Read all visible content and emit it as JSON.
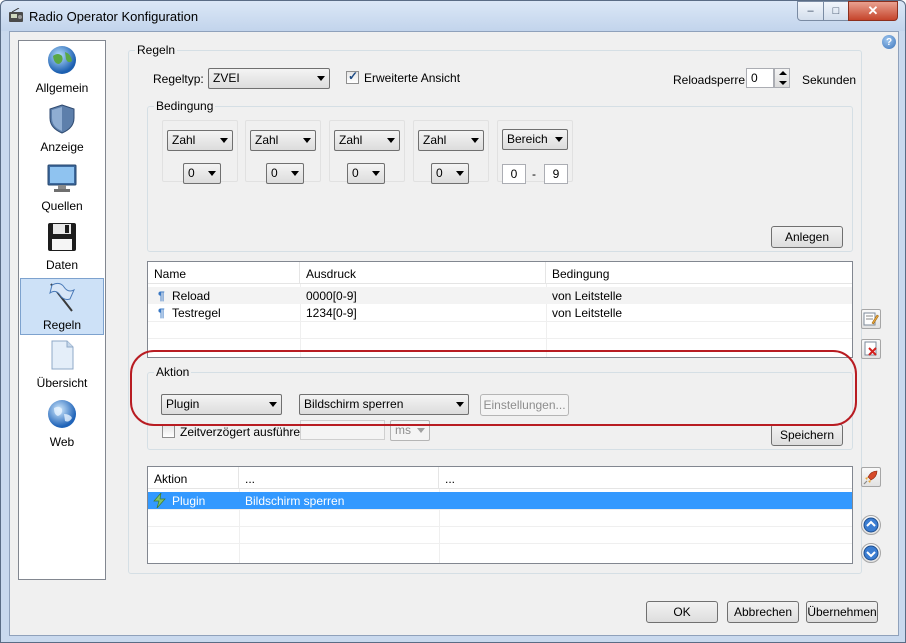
{
  "window": {
    "title": "Radio Operator Konfiguration",
    "minimize_glyph": "–",
    "maximize_glyph": "□",
    "close_glyph": "✕"
  },
  "help_glyph": "?",
  "sidebar": {
    "items": [
      {
        "label": "Allgemein",
        "icon": "globe-icon"
      },
      {
        "label": "Anzeige",
        "icon": "shield-icon"
      },
      {
        "label": "Quellen",
        "icon": "monitor-icon"
      },
      {
        "label": "Daten",
        "icon": "floppy-disk-icon"
      },
      {
        "label": "Regeln",
        "icon": "flag-icon",
        "active": true
      },
      {
        "label": "Übersicht",
        "icon": "document-icon"
      },
      {
        "label": "Web",
        "icon": "globe-icon"
      }
    ]
  },
  "rules_group": {
    "title": "Regeln",
    "regeltyp_label": "Regeltyp:",
    "regeltyp_value": "ZVEI",
    "extended_view_label": "Erweiterte Ansicht",
    "extended_view_checked": true,
    "reload_label": "Reloadsperre:",
    "reload_value": "0",
    "reload_unit": "Sekunden"
  },
  "condition_group": {
    "title": "Bedingung",
    "slots": [
      {
        "type": "Zahl",
        "value": "0"
      },
      {
        "type": "Zahl",
        "value": "0"
      },
      {
        "type": "Zahl",
        "value": "0"
      },
      {
        "type": "Zahl",
        "value": "0"
      }
    ],
    "range": {
      "type": "Bereich",
      "from": "0",
      "separator": "-",
      "to": "9"
    },
    "add_button": "Anlegen"
  },
  "rules_table": {
    "columns": [
      "Name",
      "Ausdruck",
      "Bedingung"
    ],
    "row_icon": "¶",
    "rows": [
      {
        "name": "Reload",
        "expression": "0000[0-9]",
        "condition": "von Leitstelle"
      },
      {
        "name": "Testregel",
        "expression": "1234[0-9]",
        "condition": "von Leitstelle"
      }
    ]
  },
  "action_group": {
    "title": "Aktion",
    "type_value": "Plugin",
    "plugin_value": "Bildschirm sperren",
    "settings_button": "Einstellungen...",
    "delayed_label": "Zeitverzögert ausführen",
    "delayed_checked": false,
    "delay_value": "",
    "delay_unit": "ms",
    "save_button": "Speichern"
  },
  "action_table": {
    "columns": [
      "Aktion",
      "...",
      "..."
    ],
    "rows": [
      {
        "action": "Plugin",
        "detail": "Bildschirm sperren",
        "extra": "",
        "selected": true
      }
    ]
  },
  "footer": {
    "ok": "OK",
    "cancel": "Abbrechen",
    "apply": "Übernehmen"
  },
  "colors": {
    "selection": "#3399ff",
    "highlight_ring": "#b81c22",
    "window_frame": "#c9d9ee"
  }
}
